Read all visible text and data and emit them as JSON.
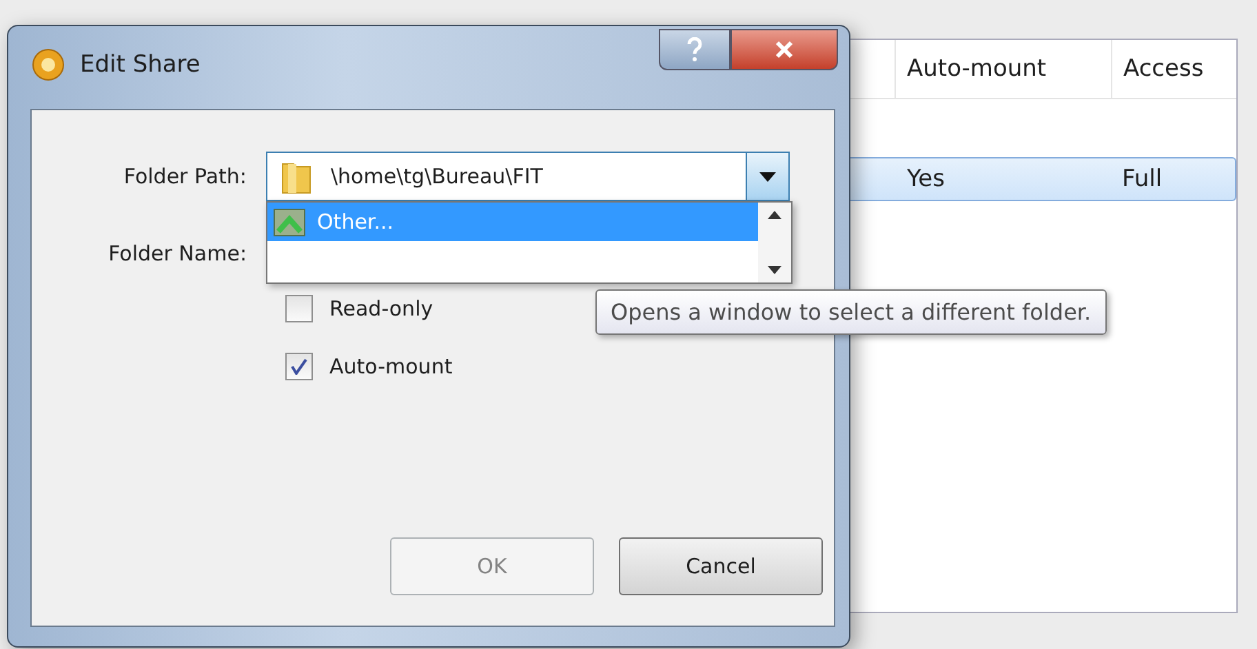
{
  "background_window": {
    "table": {
      "columns": [
        "Auto-mount",
        "Access"
      ],
      "rows": [
        {
          "cells": [
            "Yes",
            "Full"
          ],
          "selected": true
        }
      ]
    }
  },
  "dialog": {
    "title": "Edit Share",
    "folder_path": {
      "label": "Folder Path:",
      "value": "\\home\\tg\\Bureau\\FIT",
      "expanded": true,
      "options": [
        {
          "label": "Other...",
          "selected": true
        }
      ]
    },
    "folder_name": {
      "label": "Folder Name:"
    },
    "checkboxes": [
      {
        "label": "Read-only",
        "checked": false
      },
      {
        "label": "Auto-mount",
        "checked": true
      }
    ],
    "buttons": [
      {
        "label": "OK",
        "disabled": true
      },
      {
        "label": "Cancel",
        "disabled": false
      }
    ]
  },
  "tooltip": {
    "text": "Opens a window to select a different folder."
  }
}
